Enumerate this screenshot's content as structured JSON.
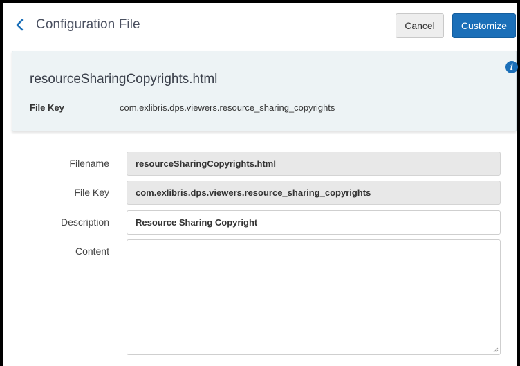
{
  "header": {
    "title": "Configuration File",
    "cancel_label": "Cancel",
    "customize_label": "Customize"
  },
  "summary": {
    "filename": "resourceSharingCopyrights.html",
    "file_key_label": "File Key",
    "file_key_value": "com.exlibris.dps.viewers.resource_sharing_copyrights"
  },
  "form": {
    "filename_label": "Filename",
    "filename_value": "resourceSharingCopyrights.html",
    "file_key_label": "File Key",
    "file_key_value": "com.exlibris.dps.viewers.resource_sharing_copyrights",
    "description_label": "Description",
    "description_value": "Resource Sharing Copyright",
    "content_label": "Content",
    "content_value": ""
  },
  "colors": {
    "primary": "#1b6fb8",
    "panel_bg": "#edf3f5",
    "readonly_bg": "#e8e8e8"
  },
  "icons": {
    "back": "chevron-left-icon",
    "info": "info-icon",
    "resize": "resize-grip-icon"
  }
}
